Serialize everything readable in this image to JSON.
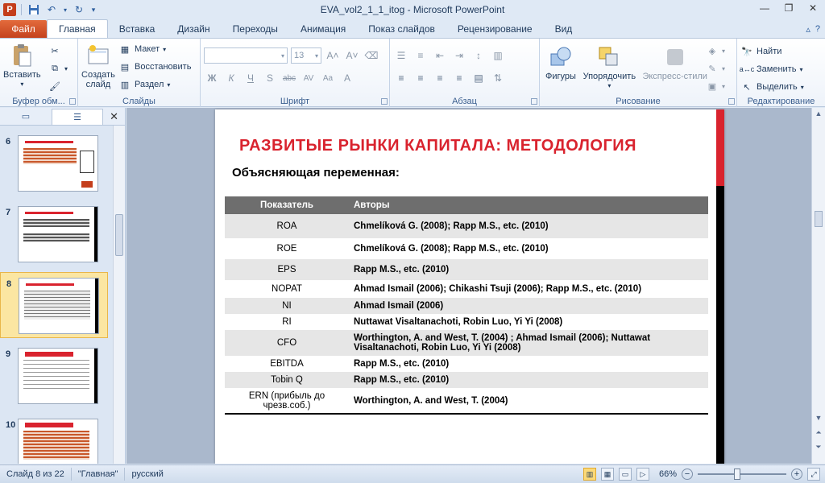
{
  "window": {
    "title": "EVA_vol2_1_1_itog  -  Microsoft PowerPoint",
    "app_letter": "P"
  },
  "tabs": {
    "file": "Файл",
    "items": [
      "Главная",
      "Вставка",
      "Дизайн",
      "Переходы",
      "Анимация",
      "Показ слайдов",
      "Рецензирование",
      "Вид"
    ],
    "active_index": 0
  },
  "ribbon": {
    "clipboard": {
      "paste": "Вставить",
      "label": "Буфер обм..."
    },
    "slides": {
      "new_slide_line1": "Создать",
      "new_slide_line2": "слайд",
      "layout": "Макет",
      "reset": "Восстановить",
      "section": "Раздел",
      "label": "Слайды"
    },
    "font": {
      "font_name": "",
      "font_size": "13",
      "label": "Шрифт",
      "bold": "Ж",
      "italic": "К",
      "underline": "Ч",
      "shadow": "S",
      "strike": "abc",
      "spacing": "AV",
      "case": "Aa",
      "color": "A"
    },
    "paragraph": {
      "label": "Абзац"
    },
    "drawing": {
      "shapes": "Фигуры",
      "arrange": "Упорядочить",
      "styles": "Экспресс-стили",
      "label": "Рисование"
    },
    "editing": {
      "find": "Найти",
      "replace": "Заменить",
      "select": "Выделить",
      "label": "Редактирование"
    }
  },
  "thumbnails": [
    {
      "num": "6"
    },
    {
      "num": "7"
    },
    {
      "num": "8",
      "selected": true
    },
    {
      "num": "9"
    },
    {
      "num": "10"
    }
  ],
  "slide": {
    "title": "РАЗВИТЫЕ  РЫНКИ  КАПИТАЛА:  МЕТОДОЛОГИЯ",
    "subtitle": "Объясняющая переменная:",
    "table": {
      "headers": [
        "Показатель",
        "Авторы"
      ],
      "rows": [
        [
          "ROA",
          "Chmelíková  G. (2008); Rapp M.S., etc. (2010)"
        ],
        [
          "ROE",
          " Chmelíková  G. (2008); Rapp M.S., etc. (2010)"
        ],
        [
          "EPS",
          "Rapp M.S., etc. (2010)"
        ],
        [
          "NOPAT",
          "Ahmad  Ismail (2006); Chikashi  Tsuji  (2006); Rapp M.S., etc. (2010)"
        ],
        [
          "NI",
          "Ahmad  Ismail (2006)"
        ],
        [
          "RI",
          "Nuttawat  Visaltanachoti,  Robin  Luo, Yi Yi (2008)"
        ],
        [
          "CFO",
          "Worthington,  A. and West, T. (2004) ; Ahmad Ismail (2006); Nuttawat Visaltanachoti,  Robin  Luo, Yi Yi (2008)"
        ],
        [
          "EBITDA",
          "Rapp M.S., etc. (2010)"
        ],
        [
          "Tobin Q",
          "Rapp M.S., etc. (2010)"
        ],
        [
          "ERN (прибыль до чрезв.соб.)",
          "Worthington,  A. and West, T. (2004)"
        ]
      ]
    }
  },
  "status": {
    "slide_info": "Слайд 8 из 22",
    "theme": "\"Главная\"",
    "language": "русский",
    "zoom": "66%"
  },
  "colors": {
    "accent_red": "#d9232e",
    "file_tab": "#c4421d",
    "table_header": "#6e6e6e"
  }
}
